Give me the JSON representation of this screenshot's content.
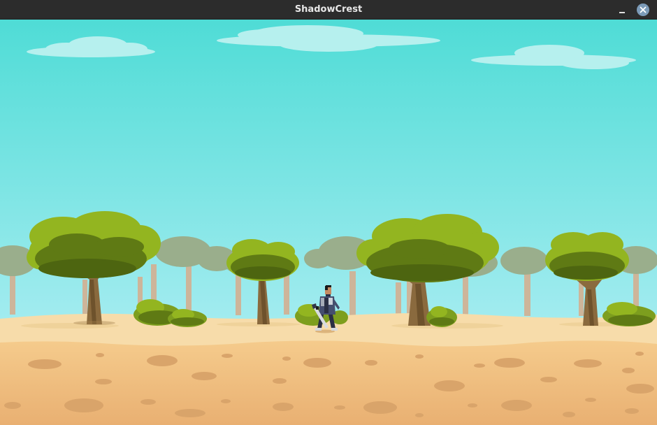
{
  "window": {
    "title": "ShadowCrest"
  },
  "controls": {
    "minimize_icon": "minimize-icon",
    "close_icon": "close-icon"
  },
  "scene": {
    "colors": {
      "sky_top": "#4fdcd6",
      "sky_bottom": "#a4ecf0",
      "cloud": "#b6f0ee",
      "far_tree_foliage": "#9aae8c",
      "far_tree_trunk": "#cdb59a",
      "tree_foliage_light": "#93b520",
      "tree_foliage_dark": "#5f7a14",
      "tree_trunk": "#8a6a3e",
      "bush": "#7d9e1e",
      "sand_light": "#f7dcaa",
      "sand": "#f2c586",
      "sand_dark": "#e8b070",
      "pebble": "#d9a46a",
      "close_button": "#7c9bb8"
    }
  }
}
